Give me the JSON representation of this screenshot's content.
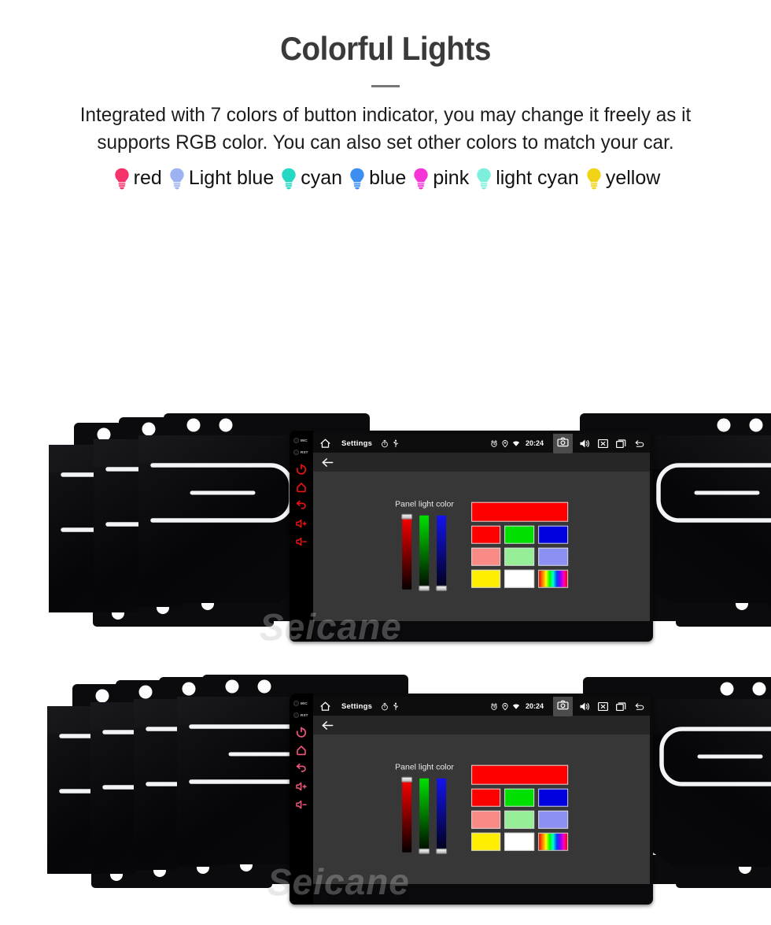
{
  "header": {
    "title": "Colorful Lights",
    "subtitle": "Integrated with 7 colors of button indicator, you may change it freely as it supports RGB color. You can also set other colors to match your car."
  },
  "legend": {
    "items": [
      {
        "label": "red",
        "color": "#f5326a",
        "icon": "bulb-icon"
      },
      {
        "label": "Light blue",
        "color": "#9db2f2",
        "icon": "bulb-icon"
      },
      {
        "label": "cyan",
        "color": "#25d8c4",
        "icon": "bulb-icon"
      },
      {
        "label": "blue",
        "color": "#3c8ef0",
        "icon": "bulb-icon"
      },
      {
        "label": "pink",
        "color": "#f535d8",
        "icon": "bulb-icon"
      },
      {
        "label": "light cyan",
        "color": "#7cf0dd",
        "icon": "bulb-icon"
      },
      {
        "label": "yellow",
        "color": "#f2d417",
        "icon": "bulb-icon"
      }
    ]
  },
  "device": {
    "side_ports": [
      {
        "label": "MIC",
        "name": "mic-port"
      },
      {
        "label": "RST",
        "name": "reset-port"
      }
    ],
    "side_buttons": [
      {
        "name": "power-button",
        "icon": "power-icon"
      },
      {
        "name": "home-button",
        "icon": "home-pentagon-icon"
      },
      {
        "name": "back-button",
        "icon": "back-arrow-icon"
      },
      {
        "name": "volume-up-button",
        "icon": "volume-up-icon"
      },
      {
        "name": "volume-down-button",
        "icon": "volume-down-icon"
      }
    ],
    "watermark": "Seicane"
  },
  "screen": {
    "statusbar": {
      "title": "Settings",
      "clock": "20:24",
      "left_icons": [
        "home-icon"
      ],
      "title_icons": [
        "stopwatch-icon",
        "usb-icon"
      ],
      "status_icons": [
        "alarm-icon",
        "location-pin-icon",
        "wifi-icon"
      ],
      "action_icons": [
        "camera-icon",
        "volume-icon",
        "close-box-icon",
        "recents-icon",
        "back-icon"
      ],
      "active_action": "camera-icon"
    },
    "actionbar": {
      "back_icon": "back-arrow-icon"
    },
    "dialog": {
      "label": "Panel light color",
      "sliders": [
        {
          "name": "red-slider",
          "channel": "R",
          "thumb": "top",
          "color": "#ff0000"
        },
        {
          "name": "green-slider",
          "channel": "G",
          "thumb": "bottom",
          "color": "#00e000"
        },
        {
          "name": "blue-slider",
          "channel": "B",
          "thumb": "bottom",
          "color": "#1414ee"
        }
      ],
      "preview_color": "#ff0000",
      "swatch_rows": [
        [
          {
            "color": "#ff0000",
            "name": "swatch-red"
          },
          {
            "color": "#00e000",
            "name": "swatch-green"
          },
          {
            "color": "#0000e0",
            "name": "swatch-blue"
          }
        ],
        [
          {
            "color": "#f98a85",
            "name": "swatch-salmon"
          },
          {
            "color": "#96ef96",
            "name": "swatch-lightgreen"
          },
          {
            "color": "#8b90f2",
            "name": "swatch-periwinkle"
          }
        ],
        [
          {
            "color": "#ffee00",
            "name": "swatch-yellow"
          },
          {
            "color": "#ffffff",
            "name": "swatch-white"
          },
          {
            "color": "rainbow",
            "name": "swatch-rainbow"
          }
        ]
      ]
    }
  },
  "rows": [
    {
      "name": "top-row",
      "left_stack": [
        {
          "name": "faceplate-left-1",
          "button_color": "#1a1a1a"
        },
        {
          "name": "faceplate-left-2",
          "button_color": "#2230ff"
        },
        {
          "name": "faceplate-left-3",
          "button_color": "#11dd33"
        }
      ],
      "right_stack": [
        {
          "name": "faceplate-right-1"
        },
        {
          "name": "faceplate-right-2"
        },
        {
          "name": "faceplate-right-3"
        }
      ],
      "front_button_color": "#ee1111"
    },
    {
      "name": "bottom-row",
      "left_stack": [
        {
          "name": "faceplate-left-1",
          "button_color": "#d8c400"
        },
        {
          "name": "faceplate-left-2",
          "button_color": "#6a2ad8"
        },
        {
          "name": "faceplate-left-3",
          "button_color": "#11cc44"
        },
        {
          "name": "faceplate-left-4",
          "button_color": "#f0557a"
        }
      ],
      "right_stack": [
        {
          "name": "faceplate-right-1"
        },
        {
          "name": "faceplate-right-2"
        },
        {
          "name": "faceplate-right-3"
        }
      ],
      "front_button_color": "#f0557a"
    }
  ]
}
